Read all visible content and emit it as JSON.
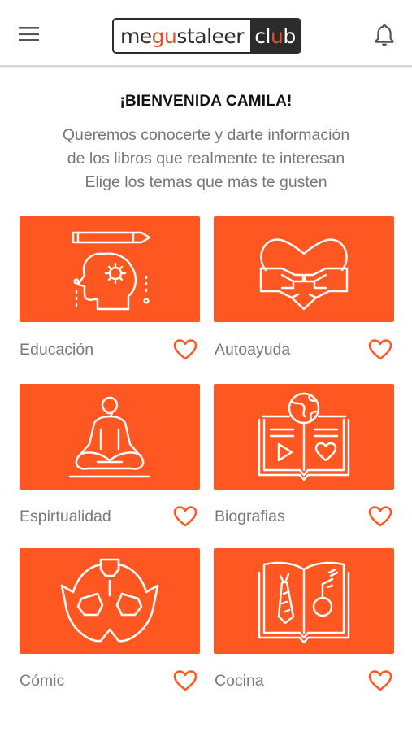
{
  "header": {
    "logo": {
      "part1": "me",
      "part2": "g",
      "part3": "u",
      "part4": "sta",
      "part5": "leer",
      "part6": "cl",
      "part7": "u",
      "part8": "b"
    },
    "menu_icon": "hamburger-menu-icon",
    "bell_icon": "bell-icon"
  },
  "welcome": {
    "title": "¡BIENVENIDA CAMILA!",
    "line1": "Queremos conocerte y darte información",
    "line2": "de los libros que realmente te interesan",
    "line3": "Elige los temas que más te gusten"
  },
  "colors": {
    "accent": "#ff5722",
    "text_muted": "#7a7a7a"
  },
  "categories": [
    {
      "label": "Educación",
      "icon": "head-gear-pencil-icon"
    },
    {
      "label": "Autoayuda",
      "icon": "heart-hands-icon"
    },
    {
      "label": "Espirtualidad",
      "icon": "meditation-icon"
    },
    {
      "label": "Biografias",
      "icon": "open-book-globe-icon"
    },
    {
      "label": "Cómic",
      "icon": "superhero-mask-icon"
    },
    {
      "label": "Cocina",
      "icon": "cookbook-icon"
    }
  ]
}
